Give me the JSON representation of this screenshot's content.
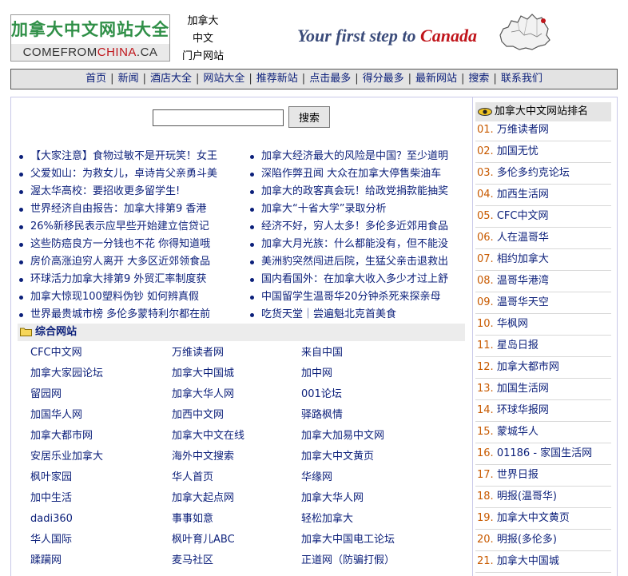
{
  "header": {
    "logo_top": "加拿大中文网站大全",
    "logo_bottom_left": "COMEFROM",
    "logo_bottom_red": "CHINA",
    "logo_bottom_right": ".CA",
    "portal_line1": "加拿大",
    "portal_line2": "中文",
    "portal_line3": "门户网站",
    "slogan_main": "Your first step to ",
    "slogan_canada": "Canada"
  },
  "nav": {
    "items": [
      "首页",
      "新闻",
      "酒店大全",
      "网站大全",
      "推荐新站",
      "点击最多",
      "得分最多",
      "最新网站",
      "搜索",
      "联系我们"
    ],
    "separator": "|"
  },
  "search": {
    "value": "",
    "button_label": "搜索"
  },
  "news": {
    "left": [
      "【大家注意】食物过敏不是开玩笑！女王",
      "父爱如山：为救女儿，卓诗肯父亲勇斗美",
      "渥太华高校：要招收更多留学生!",
      "世界经济自由报告：加拿大排第9 香港",
      "26%新移民表示应早些开始建立信贷记",
      "这些防癌良方一分钱也不花 你得知道哦",
      "房价高涨迫穷人离开 大多区近郊领食品",
      "环球活力加拿大排第9 外贸汇率制度获",
      "加拿大惊现100塑料伪钞 如何辨真假",
      "世界最贵城市榜 多伦多蒙特利尔都在前"
    ],
    "right": [
      "加拿大经济最大的风险是中国？至少道明",
      "深陷作弊丑闻 大众在加拿大停售柴油车",
      "加拿大的政客真会玩！给政党捐款能抽奖",
      "加拿大“十省大学”录取分析",
      "经济不好，穷人太多！多伦多近郊用食品",
      "加拿大月光族：什么都能没有，但不能没",
      "美洲豹突然闯进后院，生猛父亲击退救出",
      "国内看国外：在加拿大收入多少才过上舒",
      "中国留学生温哥华20分钟杀死来探亲母",
      "吃货天堂｜尝遍魁北克首美食"
    ]
  },
  "section": {
    "title": "综合网站"
  },
  "sites": [
    [
      "CFC中文网",
      "万维读者网",
      "来自中国"
    ],
    [
      "加拿大家园论坛",
      "加拿大中国城",
      "加中网"
    ],
    [
      "留园网",
      "加拿大华人网",
      "001论坛"
    ],
    [
      "加国华人网",
      "加西中文网",
      "驿路枫情"
    ],
    [
      "加拿大都市网",
      "加拿大中文在线",
      "加拿大加易中文网"
    ],
    [
      "安居乐业加拿大",
      "海外中文搜索",
      "加拿大中文黄页"
    ],
    [
      "枫叶家园",
      "华人首页",
      "华缘网"
    ],
    [
      "加中生活",
      "加拿大起点网",
      "加拿大华人网"
    ],
    [
      "dadi360",
      "事事如意",
      "轻松加拿大"
    ],
    [
      "华人国际",
      "枫叶育儿ABC",
      "加拿大中国电工论坛"
    ],
    [
      "蹂躏网",
      "麦马社区",
      "正道网（防骗打假）"
    ]
  ],
  "ranking": {
    "title": "加拿大中文网站排名",
    "items": [
      {
        "num": "01.",
        "name": "万维读者网"
      },
      {
        "num": "02.",
        "name": "加国无忧"
      },
      {
        "num": "03.",
        "name": "多伦多约克论坛"
      },
      {
        "num": "04.",
        "name": "加西生活网"
      },
      {
        "num": "05.",
        "name": "CFC中文网"
      },
      {
        "num": "06.",
        "name": "人在温哥华"
      },
      {
        "num": "07.",
        "name": "相约加拿大"
      },
      {
        "num": "08.",
        "name": "温哥华港湾"
      },
      {
        "num": "09.",
        "name": "温哥华天空"
      },
      {
        "num": "10.",
        "name": "华枫网"
      },
      {
        "num": "11.",
        "name": "星岛日报"
      },
      {
        "num": "12.",
        "name": "加拿大都市网"
      },
      {
        "num": "13.",
        "name": "加国生活网"
      },
      {
        "num": "14.",
        "name": "环球华报网"
      },
      {
        "num": "15.",
        "name": "蒙城华人"
      },
      {
        "num": "16.",
        "name": "01186 - 家国生活网"
      },
      {
        "num": "17.",
        "name": "世界日报"
      },
      {
        "num": "18.",
        "name": "明报(温哥华)"
      },
      {
        "num": "19.",
        "name": "加拿大中文黄页"
      },
      {
        "num": "20.",
        "name": "明报(多伦多)"
      },
      {
        "num": "21.",
        "name": "加拿大中国城"
      }
    ]
  }
}
